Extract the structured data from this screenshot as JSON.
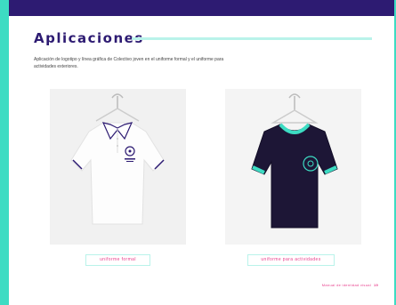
{
  "header": {
    "title": "Aplicaciones"
  },
  "intro": {
    "text": "Aplicación de logotipo y línea gráfica de Colectivo joven en el uniforme formal y el uniforme para actividades exteriores."
  },
  "photos": {
    "left_caption": "uniforme formal",
    "right_caption": "uniforme para actividades"
  },
  "footer": {
    "section": "Manual de identidad visual",
    "page_number": "19"
  },
  "colors": {
    "brand_purple": "#2d1b72",
    "accent_teal": "#3ddcc3",
    "accent_pink": "#e83e8c"
  }
}
